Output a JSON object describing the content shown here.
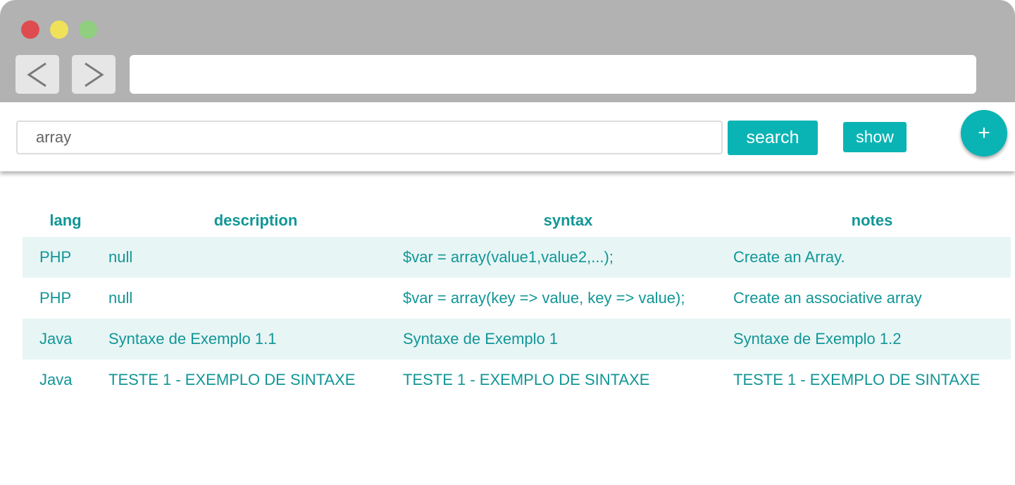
{
  "search": {
    "value": "array",
    "button_label": "search"
  },
  "toolbar": {
    "show_label": "show",
    "add_label": "+"
  },
  "table": {
    "headers": {
      "lang": "lang",
      "description": "description",
      "syntax": "syntax",
      "notes": "notes"
    },
    "rows": [
      {
        "lang": "PHP",
        "description": "null",
        "syntax": "$var = array(value1,value2,...);",
        "notes": "Create an Array."
      },
      {
        "lang": "PHP",
        "description": "null",
        "syntax": "$var = array(key => value, key => value);",
        "notes": "Create an associative array"
      },
      {
        "lang": "Java",
        "description": "Syntaxe de Exemplo 1.1",
        "syntax": "Syntaxe de Exemplo 1",
        "notes": "Syntaxe de Exemplo 1.2"
      },
      {
        "lang": "Java",
        "description": "TESTE 1 - EXEMPLO DE SINTAXE",
        "syntax": "TESTE 1 - EXEMPLO DE SINTAXE",
        "notes": "TESTE 1 - EXEMPLO DE SINTAXE"
      }
    ]
  },
  "colors": {
    "accent": "#0bb4b4",
    "text": "#129696",
    "stripe": "#e8f5f5",
    "chrome": "#b2b2b2"
  }
}
